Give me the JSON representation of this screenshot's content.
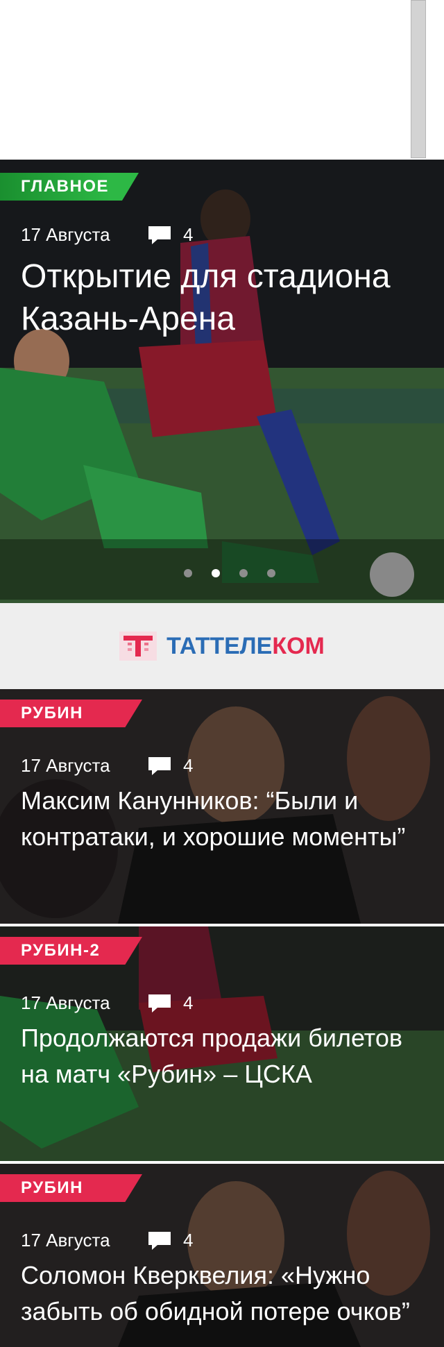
{
  "featured": {
    "tag": "ГЛАВНОЕ",
    "date": "17 Августа",
    "comments": "4",
    "title": "Открытие для стадиона Казань-Арена",
    "slides_total": 4,
    "slide_active": 2
  },
  "banner": {
    "brand_part1": "ТАТТЕЛЕ",
    "brand_part2": "КОМ",
    "colors": {
      "blue": "#2a6cb5",
      "red": "#e4294f"
    }
  },
  "news": [
    {
      "tag": "РУБИН",
      "date": "17 Августа",
      "comments": "4",
      "title": "Максим Канунников: “Были и контратаки, и хорошие моменты”"
    },
    {
      "tag": "РУБИН-2",
      "date": "17 Августа",
      "comments": "4",
      "title": "Продолжаются продажи билетов на матч «Рубин» – ЦСКА"
    },
    {
      "tag": "РУБИН",
      "date": "17 Августа",
      "comments": "4",
      "title": "Соломон Кверквелия: «Нужно забыть об обидной потере очков”"
    }
  ],
  "icons": {
    "comment": "comment-bubble-icon",
    "logo": "tattelecom-logo-icon"
  },
  "colors": {
    "tag_green": "#2db845",
    "tag_red": "#e4294f"
  }
}
